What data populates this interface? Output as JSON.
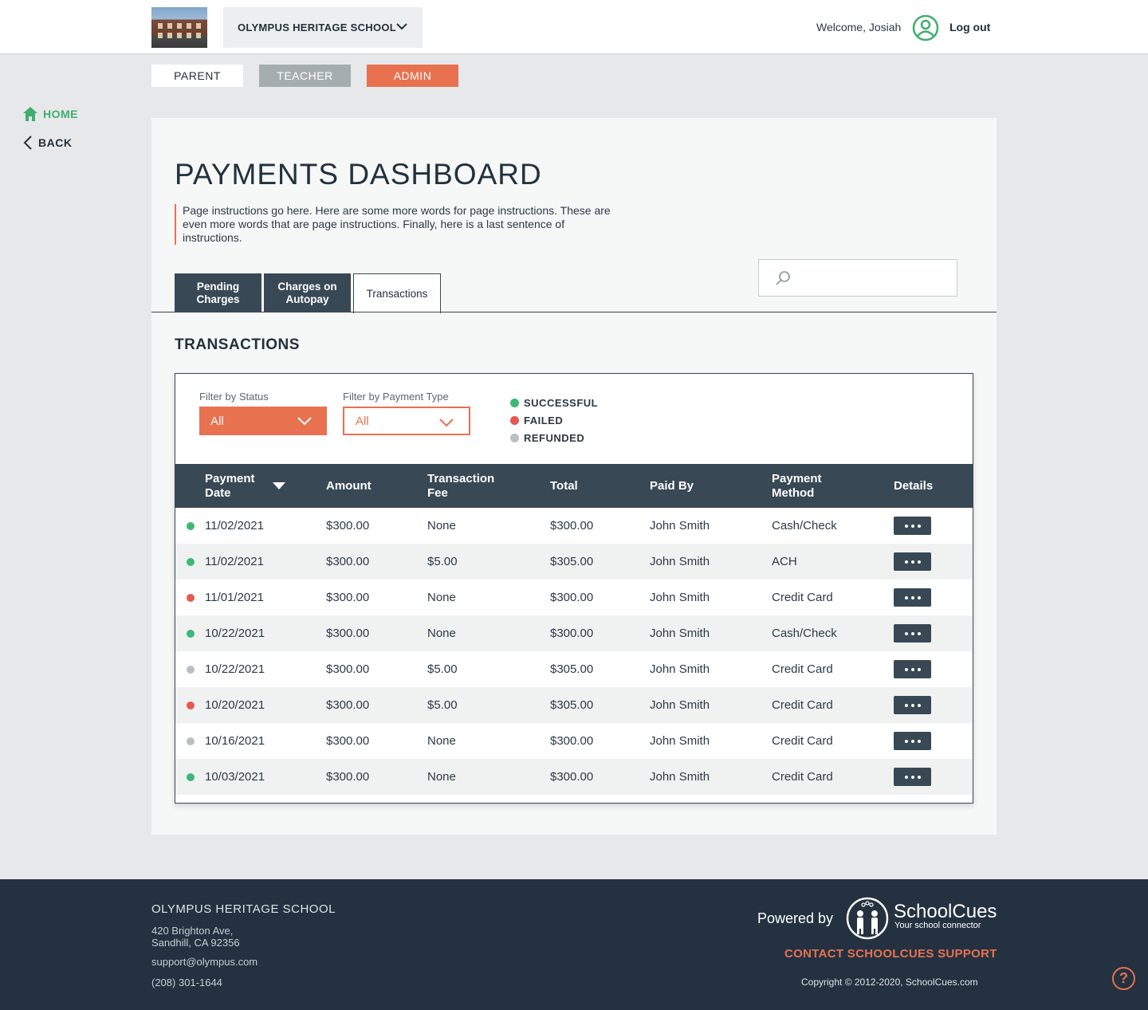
{
  "header": {
    "school_name": "OLYMPUS HERITAGE SCHOOL",
    "welcome": "Welcome, Josiah",
    "logout": "Log out"
  },
  "roles": {
    "parent": "PARENT",
    "teacher": "TEACHER",
    "admin": "ADMIN"
  },
  "side_nav": {
    "home": "HOME",
    "back": "BACK"
  },
  "page": {
    "title": "PAYMENTS DASHBOARD",
    "instructions": "Page instructions go here. Here are some more words for page instructions. These are even more words that are page instructions. Finally, here is a last sentence of instructions.",
    "tabs": {
      "pending": "Pending Charges",
      "autopay": "Charges on Autopay",
      "transactions": "Transactions"
    },
    "search_placeholder": "",
    "section_title": "TRANSACTIONS"
  },
  "filters": {
    "status_label": "Filter by Status",
    "status_value": "All",
    "type_label": "Filter by Payment Type",
    "type_value": "All"
  },
  "legend": {
    "successful": "SUCCESSFUL",
    "failed": "FAILED",
    "refunded": "REFUNDED"
  },
  "colors": {
    "successful": "#3cb878",
    "failed": "#e8574f",
    "refunded": "#b9bec2",
    "accent": "#e87150",
    "dark": "#384855"
  },
  "table": {
    "headers": {
      "payment_date": "Payment Date",
      "amount": "Amount",
      "fee": "Transaction Fee",
      "total": "Total",
      "paid_by": "Paid By",
      "method": "Payment Method",
      "details": "Details"
    },
    "rows": [
      {
        "status": "successful",
        "date": "11/02/2021",
        "amount": "$300.00",
        "fee": "None",
        "total": "$300.00",
        "paid_by": "John Smith",
        "method": "Cash/Check"
      },
      {
        "status": "successful",
        "date": "11/02/2021",
        "amount": "$300.00",
        "fee": "$5.00",
        "total": "$305.00",
        "paid_by": "John Smith",
        "method": "ACH"
      },
      {
        "status": "failed",
        "date": "11/01/2021",
        "amount": "$300.00",
        "fee": "None",
        "total": "$300.00",
        "paid_by": "John Smith",
        "method": "Credit Card"
      },
      {
        "status": "successful",
        "date": "10/22/2021",
        "amount": "$300.00",
        "fee": "None",
        "total": "$300.00",
        "paid_by": "John Smith",
        "method": "Cash/Check"
      },
      {
        "status": "refunded",
        "date": "10/22/2021",
        "amount": "$300.00",
        "fee": "$5.00",
        "total": "$305.00",
        "paid_by": "John Smith",
        "method": "Credit Card"
      },
      {
        "status": "failed",
        "date": "10/20/2021",
        "amount": "$300.00",
        "fee": "$5.00",
        "total": "$305.00",
        "paid_by": "John Smith",
        "method": "Credit Card"
      },
      {
        "status": "refunded",
        "date": "10/16/2021",
        "amount": "$300.00",
        "fee": "None",
        "total": "$300.00",
        "paid_by": "John Smith",
        "method": "Credit Card"
      },
      {
        "status": "successful",
        "date": "10/03/2021",
        "amount": "$300.00",
        "fee": "None",
        "total": "$300.00",
        "paid_by": "John Smith",
        "method": "Credit Card"
      }
    ]
  },
  "footer": {
    "school_name": "OLYMPUS HERITAGE SCHOOL",
    "address_line1": "420 Brighton Ave,",
    "address_line2": "Sandhill, CA 92356",
    "email": "support@olympus.com",
    "phone": "(208) 301-1644",
    "powered_by": "Powered by",
    "brand": "SchoolCues",
    "tagline": "Your school connector",
    "contact": "CONTACT SCHOOLCUES SUPPORT",
    "copyright": "Copyright © 2012-2020, SchoolCues.com",
    "help": "?"
  }
}
